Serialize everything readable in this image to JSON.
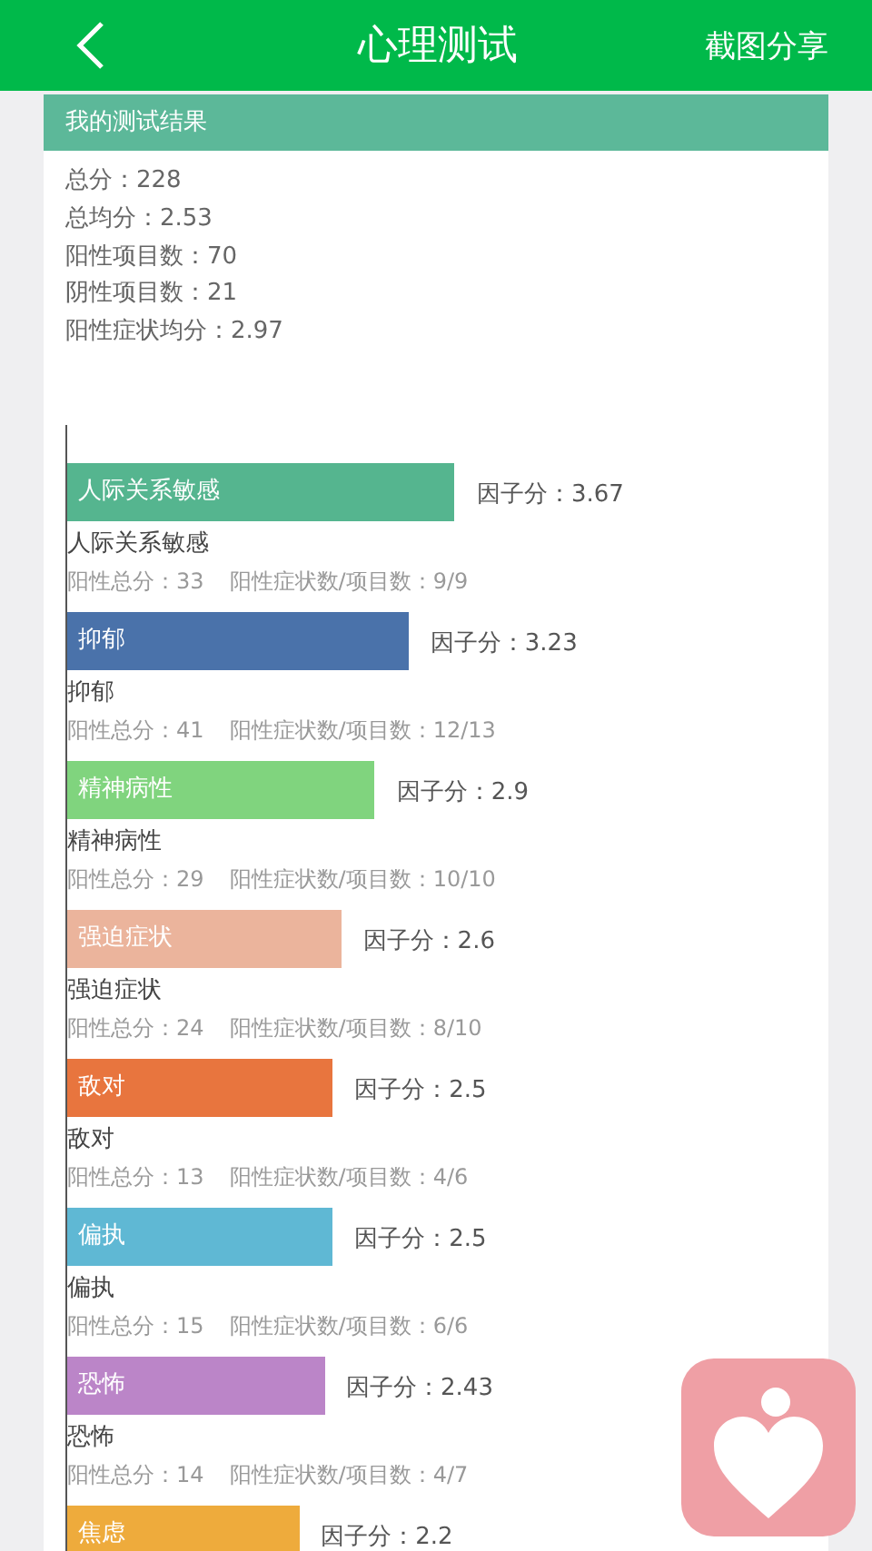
{
  "header": {
    "title": "心理测试",
    "action": "截图分享"
  },
  "card": {
    "title": "我的测试结果",
    "stats": [
      "总分：228",
      "总均分：2.53",
      "阳性项目数：70",
      "阴性项目数：21",
      "阳性症状均分：2.97"
    ],
    "factors": [
      {
        "name": "人际关系敏感",
        "color": "#55b58f",
        "level": 0.92,
        "score": "因子分：3.67",
        "label": "人际关系敏感",
        "total": "阳性总分：33",
        "ratio": "阳性症状数/项目数：9/9"
      },
      {
        "name": "抑郁",
        "color": "#4a72aa",
        "level": 0.81,
        "score": "因子分：3.23",
        "label": "抑郁",
        "total": "阳性总分：41",
        "ratio": "阳性症状数/项目数：12/13"
      },
      {
        "name": "精神病性",
        "color": "#80d47e",
        "level": 0.73,
        "score": "因子分：2.9",
        "label": "精神病性",
        "total": "阳性总分：29",
        "ratio": "阳性症状数/项目数：10/10"
      },
      {
        "name": "强迫症状",
        "color": "#ebb49c",
        "level": 0.65,
        "score": "因子分：2.6",
        "label": "强迫症状",
        "total": "阳性总分：24",
        "ratio": "阳性症状数/项目数：8/10"
      },
      {
        "name": "敌对",
        "color": "#e8753e",
        "level": 0.63,
        "score": "因子分：2.5",
        "label": "敌对",
        "total": "阳性总分：13",
        "ratio": "阳性症状数/项目数：4/6"
      },
      {
        "name": "偏执",
        "color": "#5fb8d4",
        "level": 0.63,
        "score": "因子分：2.5",
        "label": "偏执",
        "total": "阳性总分：15",
        "ratio": "阳性症状数/项目数：6/6"
      },
      {
        "name": "恐怖",
        "color": "#bb85c8",
        "level": 0.61,
        "score": "因子分：2.43",
        "label": "恐怖",
        "total": "阳性总分：14",
        "ratio": "阳性症状数/项目数：4/7"
      },
      {
        "name": "焦虑",
        "color": "#eeab3c",
        "level": 0.55,
        "score": "因子分：2.2"
      }
    ]
  }
}
